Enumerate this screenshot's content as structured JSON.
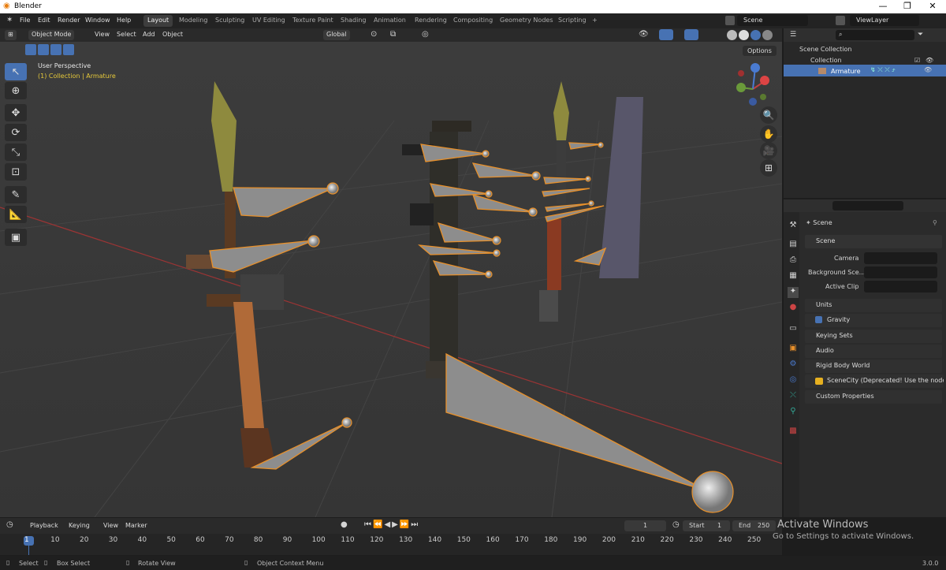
{
  "window": {
    "title": "Blender",
    "min": "—",
    "max": "❐",
    "close": "✕"
  },
  "menus": [
    "File",
    "Edit",
    "Render",
    "Window",
    "Help"
  ],
  "tabs": [
    "Layout",
    "Modeling",
    "Sculpting",
    "UV Editing",
    "Texture Paint",
    "Shading",
    "Animation",
    "Rendering",
    "Compositing",
    "Geometry Nodes",
    "Scripting",
    "+"
  ],
  "scene_name": "Scene",
  "view_layer": "ViewLayer",
  "vp_header": {
    "mode": "Object Mode",
    "view": "View",
    "select": "Select",
    "add": "Add",
    "object": "Object",
    "orientation": "Global",
    "options": "Options"
  },
  "overlay": {
    "perspective": "User Perspective",
    "collection": "(1) Collection | Armature"
  },
  "outliner": {
    "root": "Scene Collection",
    "collection": "Collection",
    "armature": "Armature"
  },
  "props": {
    "scene_label": "Scene",
    "section": "Scene",
    "camera": "Camera",
    "background": "Background Sce...",
    "clip": "Active Clip",
    "panels": [
      "Units",
      "Gravity",
      "Keying Sets",
      "Audio",
      "Rigid Body World",
      "SceneCity (Deprecated! Use the nodes in",
      "Custom Properties"
    ]
  },
  "timeline": {
    "playback": "Playback",
    "keying": "Keying",
    "view": "View",
    "marker": "Marker",
    "current": "1",
    "start_label": "Start",
    "start": "1",
    "end_label": "End",
    "end": "250",
    "ticks": [
      "1",
      "10",
      "20",
      "30",
      "40",
      "50",
      "60",
      "70",
      "80",
      "90",
      "100",
      "110",
      "120",
      "130",
      "140",
      "150",
      "160",
      "170",
      "180",
      "190",
      "200",
      "210",
      "220",
      "230",
      "240",
      "250"
    ]
  },
  "status": {
    "select": "Select",
    "box": "Box Select",
    "rotate": "Rotate View",
    "context": "Object Context Menu",
    "version": "3.0.0"
  },
  "watermark": {
    "line1": "Activate Windows",
    "line2": "Go to Settings to activate Windows."
  },
  "colors": {
    "accent": "#4772b3",
    "bone_outline": "#e8902a",
    "grid_red": "#9b3434",
    "text_yellow": "#e6c93b"
  }
}
